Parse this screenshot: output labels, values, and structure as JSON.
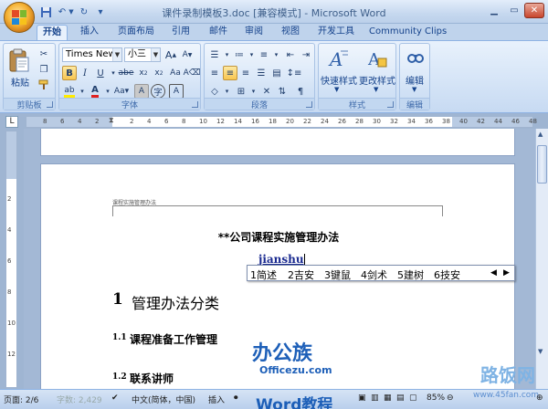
{
  "window": {
    "title": "课件录制模板3.doc [兼容模式] - Microsoft Word"
  },
  "tabs": [
    "开始",
    "插入",
    "页面布局",
    "引用",
    "邮件",
    "审阅",
    "视图",
    "开发工具",
    "Community Clips"
  ],
  "ribbon": {
    "clipboard": {
      "label": "剪贴板",
      "paste": "粘贴"
    },
    "font": {
      "label": "字体",
      "name": "Times New R",
      "size": "小三"
    },
    "paragraph": {
      "label": "段落"
    },
    "styles": {
      "label": "样式",
      "quick": "快速样式",
      "change": "更改样式"
    },
    "editing": {
      "label": "编辑",
      "edit": "编辑"
    }
  },
  "ruler": {
    "h_ticks": [
      "8",
      "6",
      "4",
      "2",
      "",
      "2",
      "4",
      "6",
      "8",
      "10",
      "12",
      "14",
      "16",
      "18",
      "20",
      "22",
      "24",
      "26",
      "28",
      "30",
      "32",
      "34",
      "36",
      "38",
      "40",
      "42",
      "44",
      "46",
      "48"
    ],
    "v_ticks": [
      "2",
      "4",
      "6",
      "8",
      "10",
      "12"
    ]
  },
  "document": {
    "header_text": "课程实施管理办法",
    "title": "**公司课程实施管理办法",
    "typed": "jianshu",
    "heading1_num": "1",
    "heading1": "管理办法分类",
    "heading2a_num": "1.1",
    "heading2a": "课程准备工作管理",
    "heading2b_num": "1.2",
    "heading2b": "联系讲师"
  },
  "ime": {
    "candidates": [
      "1简述",
      "2吉安",
      "3键鼠",
      "4剑术",
      "5建树",
      "6技安"
    ]
  },
  "status": {
    "page": "页面: 2/6",
    "words": "字数: 2,429",
    "lang": "中文(简体，中国)",
    "mode": "插入",
    "zoom": "85%"
  },
  "watermarks": {
    "brand1": "办公族",
    "brand1_url": "Officezu.com",
    "brand1_sub": "Word教程",
    "brand2": "路饭网",
    "brand2_url": "www.45fan.com"
  }
}
